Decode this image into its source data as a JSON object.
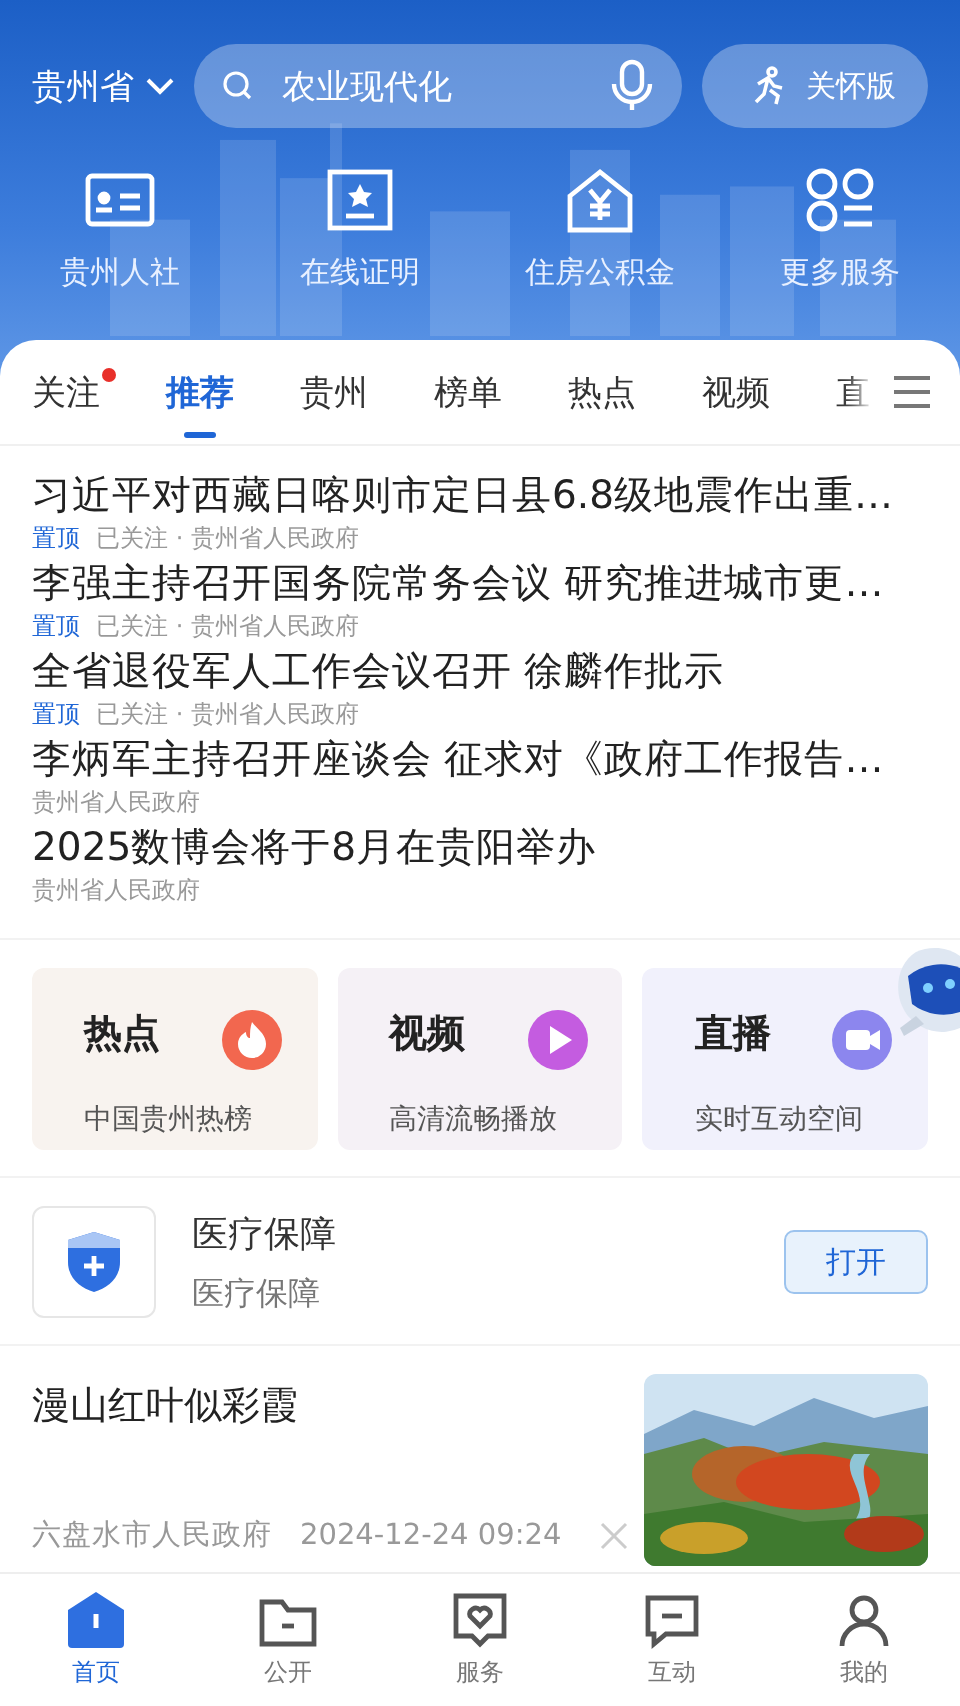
{
  "header": {
    "region": "贵州省",
    "search": {
      "placeholder": "农业现代化"
    },
    "care_button": "关怀版",
    "shortcuts": [
      {
        "kind": "card",
        "label": "贵州人社"
      },
      {
        "kind": "certificate",
        "label": "在线证明"
      },
      {
        "kind": "house",
        "label": "住房公积金"
      },
      {
        "kind": "grid",
        "label": "更多服务"
      }
    ]
  },
  "tabs": [
    {
      "label": "关注",
      "selected": false,
      "dot": true
    },
    {
      "label": "推荐",
      "selected": true,
      "dot": false
    },
    {
      "label": "贵州",
      "selected": false,
      "dot": false
    },
    {
      "label": "榜单",
      "selected": false,
      "dot": false
    },
    {
      "label": "热点",
      "selected": false,
      "dot": false
    },
    {
      "label": "视频",
      "selected": false,
      "dot": false
    },
    {
      "label": "直",
      "selected": false,
      "dot": false
    }
  ],
  "news": [
    {
      "title": "习近平对西藏日喀则市定日县6.8级地震作出重…",
      "tag": "置顶",
      "meta": "已关注 · 贵州省人民政府"
    },
    {
      "title": "李强主持召开国务院常务会议 研究推进城市更…",
      "tag": "置顶",
      "meta": "已关注 · 贵州省人民政府"
    },
    {
      "title": "全省退役军人工作会议召开 徐麟作批示",
      "tag": "置顶",
      "meta": "已关注 · 贵州省人民政府"
    },
    {
      "title": "李炳军主持召开座谈会 征求对《政府工作报告…",
      "meta": "贵州省人民政府"
    },
    {
      "title": "2025数博会将于8月在贵阳举办",
      "meta": "贵州省人民政府"
    }
  ],
  "cards": [
    {
      "kind": "fire",
      "title": "热点",
      "subtitle": "中国贵州热榜",
      "color": "#f2674f"
    },
    {
      "kind": "play",
      "title": "视频",
      "subtitle": "高清流畅播放",
      "color": "#c45ce0"
    },
    {
      "kind": "live",
      "title": "直播",
      "subtitle": "实时互动空间",
      "color": "#8c86ee"
    }
  ],
  "service": {
    "title": "医疗保障",
    "subtitle": "医疗保障",
    "button": "打开"
  },
  "article": {
    "title": "漫山红叶似彩霞",
    "source": "六盘水市人民政府",
    "time": "2024-12-24 09:24"
  },
  "nav": [
    {
      "kind": "home",
      "label": "首页",
      "selected": true
    },
    {
      "kind": "folder",
      "label": "公开",
      "selected": false
    },
    {
      "kind": "heart",
      "label": "服务",
      "selected": false
    },
    {
      "kind": "chat",
      "label": "互动",
      "selected": false
    },
    {
      "kind": "user",
      "label": "我的",
      "selected": false
    }
  ]
}
